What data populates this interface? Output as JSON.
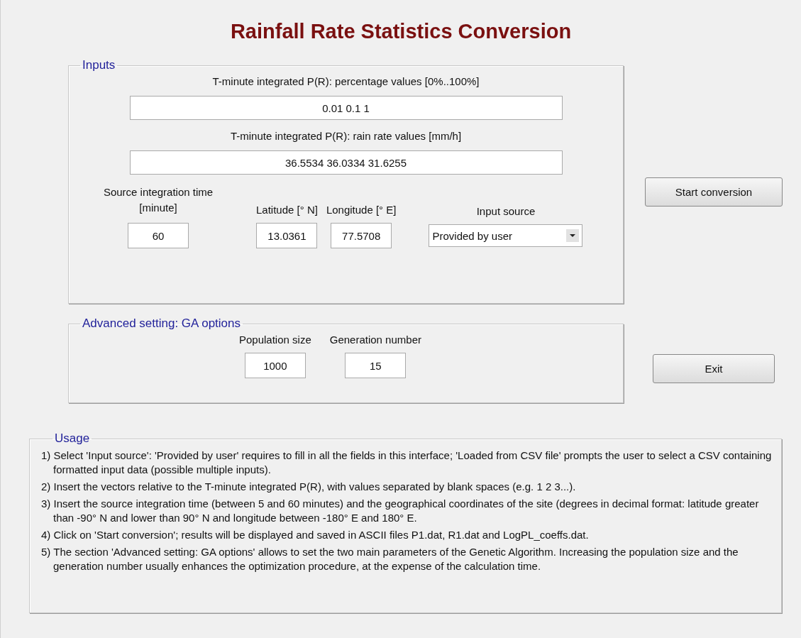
{
  "window": {
    "title": "Rainfall Rate Statistics Conversion"
  },
  "inputs": {
    "legend": "Inputs",
    "percentage": {
      "label": "T-minute integrated P(R): percentage values [0%..100%]",
      "value": "0.01 0.1 1"
    },
    "rain_rate": {
      "label": "T-minute integrated P(R): rain rate values [mm/h]",
      "value": "36.5534 36.0334 31.6255"
    },
    "integration_time": {
      "label": "Source integration time [minute]",
      "value": "60"
    },
    "latitude": {
      "label": "Latitude [° N]",
      "value": "13.0361"
    },
    "longitude": {
      "label": "Longitude [° E]",
      "value": "77.5708"
    },
    "input_source": {
      "label": "Input source",
      "value": "Provided by user"
    }
  },
  "advanced": {
    "legend": "Advanced setting: GA options",
    "population": {
      "label": "Population size",
      "value": "1000"
    },
    "generations": {
      "label": "Generation number",
      "value": "15"
    }
  },
  "buttons": [
    "Start conversion",
    "Exit"
  ],
  "usage": {
    "legend": "Usage",
    "items": [
      "1) Select 'Input source': 'Provided by user' requires  to fill in all the fields in this interface; 'Loaded from CSV file' prompts the user to select a CSV containing formatted input data (possible multiple inputs).",
      "2) Insert the vectors relative to the T-minute integrated P(R), with values separated by blank spaces (e.g. 1 2 3...).",
      "3) Insert the source integration time (between 5 and 60 minutes) and the geographical coordinates of the site (degrees in decimal format: latitude greater than -90° N and lower than 90° N and longitude between -180° E and 180° E.",
      "4) Click on 'Start conversion'; results will be displayed and saved in ASCII files P1.dat, R1.dat and LogPL_coeffs.dat.",
      "5) The section 'Advanced setting: GA options' allows to set the two main parameters of the Genetic Algorithm. Increasing the population size and the generation number usually enhances the optimization procedure, at the expense of the calculation time."
    ]
  }
}
